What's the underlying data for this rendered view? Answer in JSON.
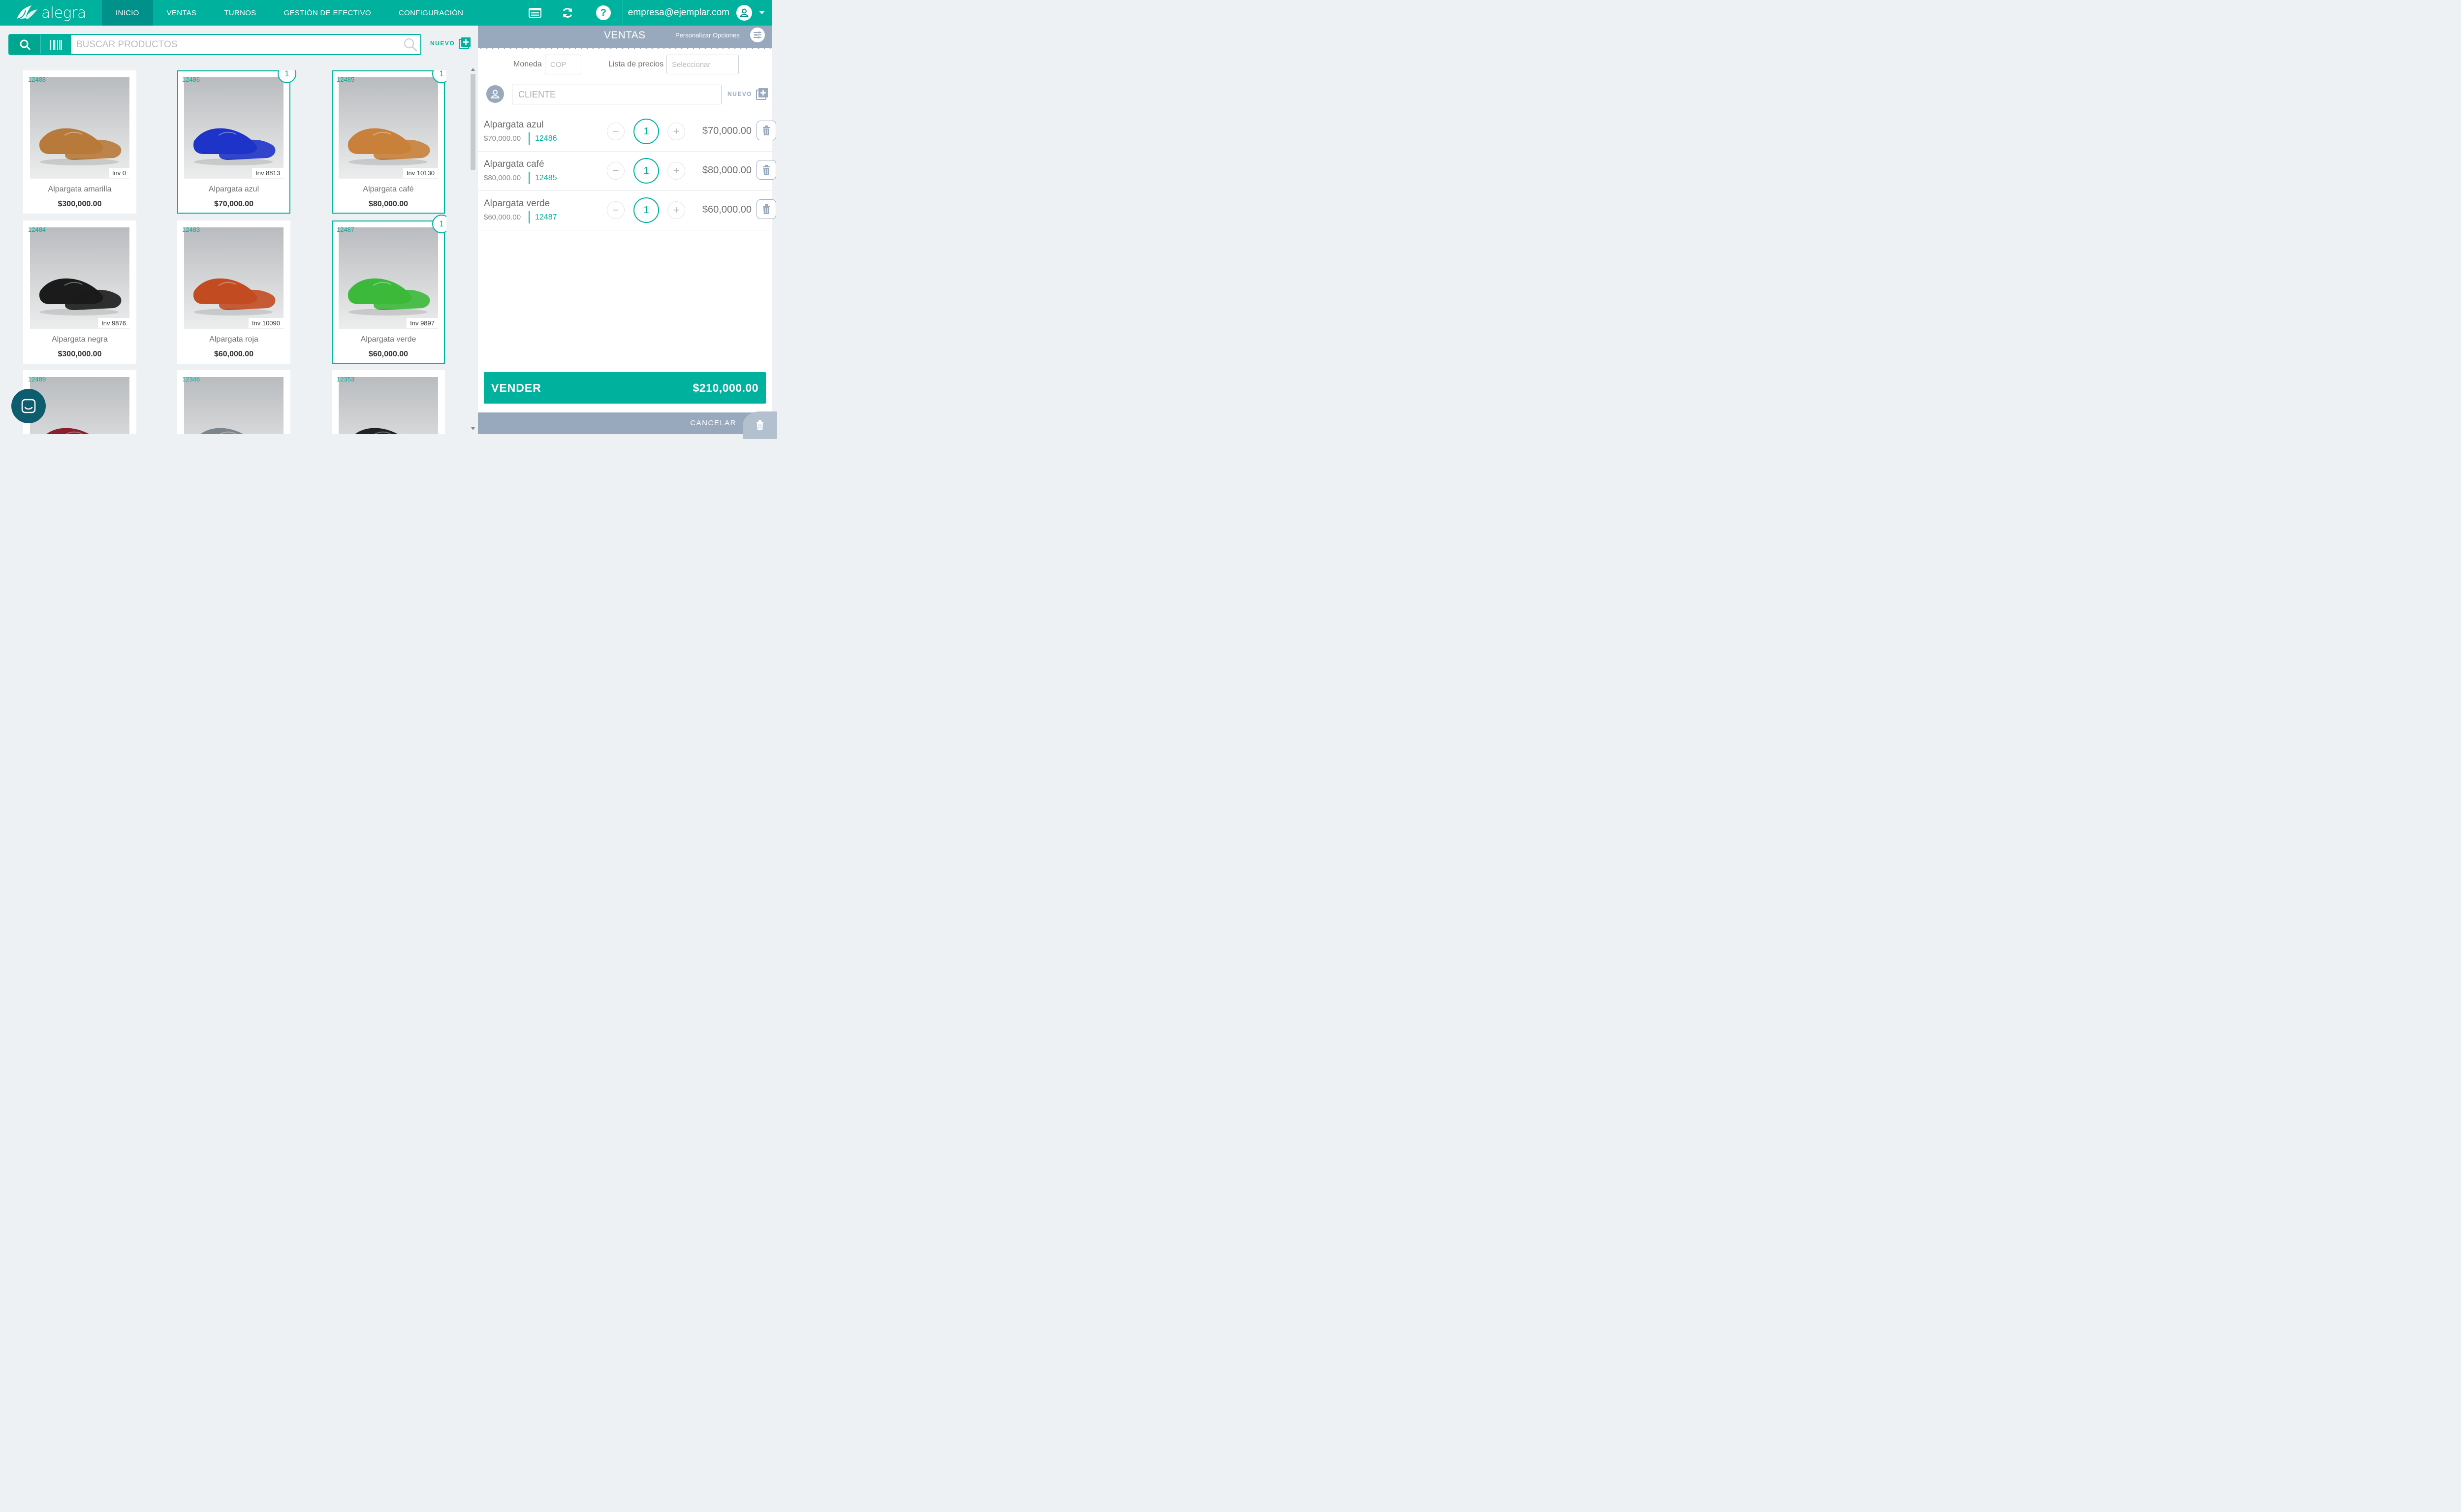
{
  "app": {
    "logo_text": "alegra"
  },
  "nav": {
    "items": [
      "INICIO",
      "VENTAS",
      "TURNOS",
      "GESTIÓN DE EFECTIVO",
      "CONFIGURACIÓN"
    ],
    "active_index": 0
  },
  "header": {
    "user_email": "empresa@ejemplar.com",
    "help_label": "?"
  },
  "search": {
    "placeholder": "BUSCAR PRODUCTOS",
    "new_label": "NUEVO"
  },
  "products": [
    {
      "code": "12488",
      "inventory": "Inv 0",
      "name": "Alpargata amarilla",
      "price": "$300,000.00",
      "color": "#b87a3a",
      "selected": false
    },
    {
      "code": "12486",
      "inventory": "Inv 8813",
      "name": "Alpargata azul",
      "price": "$70,000.00",
      "color": "#1e33c8",
      "selected": true,
      "badge": "1"
    },
    {
      "code": "12485",
      "inventory": "Inv 10130",
      "name": "Alpargata café",
      "price": "$80,000.00",
      "color": "#c9803a",
      "selected": true,
      "badge": "1"
    },
    {
      "code": "12484",
      "inventory": "Inv 9876",
      "name": "Alpargata negra",
      "price": "$300,000.00",
      "color": "#1b1b1b",
      "selected": false
    },
    {
      "code": "12483",
      "inventory": "Inv 10090",
      "name": "Alpargata roja",
      "price": "$60,000.00",
      "color": "#c24b22",
      "selected": false
    },
    {
      "code": "12487",
      "inventory": "Inv 9897",
      "name": "Alpargata verde",
      "price": "$60,000.00",
      "color": "#3cb93a",
      "selected": true,
      "badge": "1"
    },
    {
      "code": "12489",
      "color": "#8b1f2e",
      "selected": false
    },
    {
      "code": "12346",
      "color": "#7d858c",
      "selected": false
    },
    {
      "code": "12353",
      "color": "#222222",
      "selected": false
    }
  ],
  "panel": {
    "title": "VENTAS",
    "customize_label": "Personalizar Opciones",
    "currency_label": "Moneda",
    "currency_value": "COP",
    "pricelist_label": "Lista de precios",
    "pricelist_placeholder": "Seleccionar",
    "client_placeholder": "CLIENTE",
    "new_client_label": "NUEVO"
  },
  "cart": [
    {
      "name": "Alpargata azul",
      "unit_price": "$70,000.00",
      "code": "12486",
      "qty": "1",
      "total": "$70,000.00"
    },
    {
      "name": "Alpargata café",
      "unit_price": "$80,000.00",
      "code": "12485",
      "qty": "1",
      "total": "$80,000.00"
    },
    {
      "name": "Alpargata verde",
      "unit_price": "$60,000.00",
      "code": "12487",
      "qty": "1",
      "total": "$60,000.00"
    }
  ],
  "checkout": {
    "sell_label": "VENDER",
    "total": "$210,000.00",
    "cancel_label": "CANCELAR"
  },
  "colors": {
    "accent": "#00b19d",
    "accent_dark": "#00918a",
    "panel_header": "#98a9bd",
    "chat": "#0e5d6e"
  }
}
